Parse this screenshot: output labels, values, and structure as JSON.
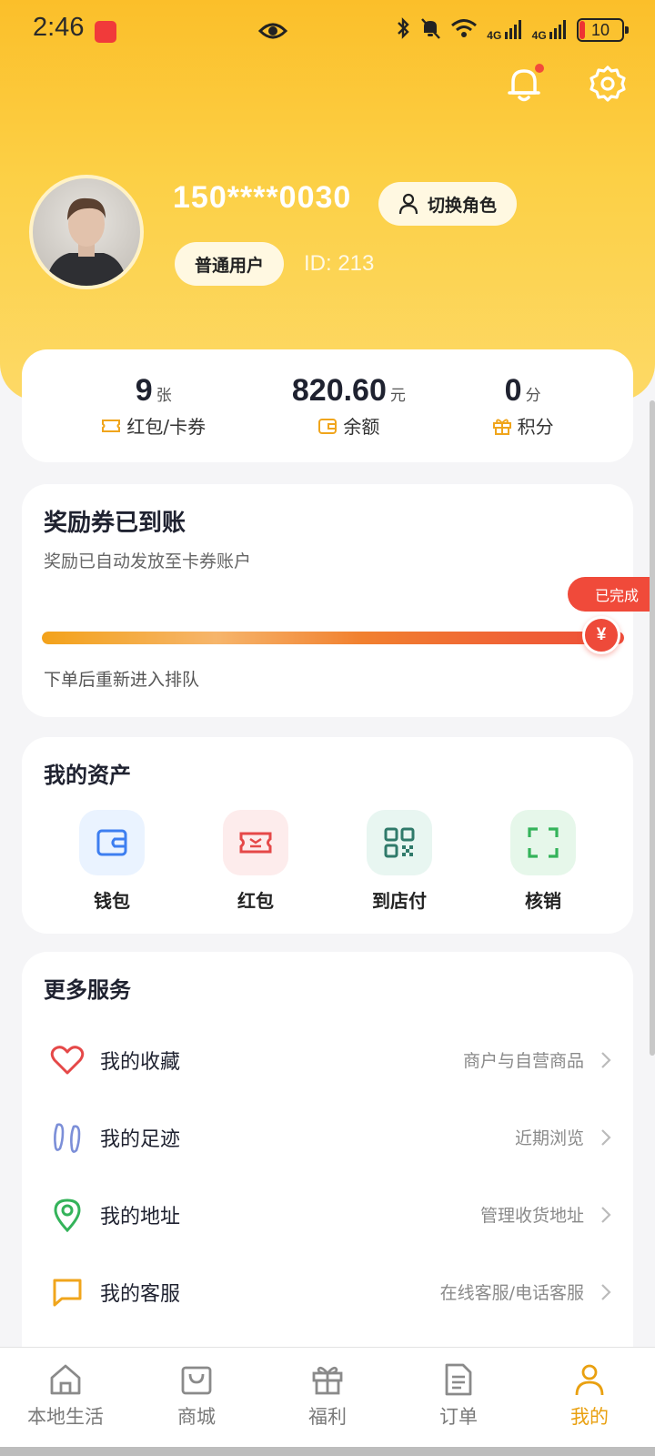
{
  "status_bar": {
    "time": "2:46",
    "network_1": "4G",
    "network_2": "4G",
    "battery": "10"
  },
  "profile": {
    "phone": "150****0030",
    "switch_role_label": "切换角色",
    "role_badge": "普通用户",
    "id_label": "ID:  213"
  },
  "stats": [
    {
      "value": "9",
      "unit": "张",
      "label": "红包/卡券",
      "icon": "ticket-icon"
    },
    {
      "value": "820.60",
      "unit": "元",
      "label": "余额",
      "icon": "wallet-icon"
    },
    {
      "value": "0",
      "unit": "分",
      "label": "积分",
      "icon": "gift-icon"
    }
  ],
  "reward": {
    "title": "奖励券已到账",
    "subtitle": "奖励已自动发放至卡券账户",
    "status_tag": "已完成",
    "knob_symbol": "¥",
    "progress": 1.0,
    "note": "下单后重新进入排队"
  },
  "assets": {
    "title": "我的资产",
    "items": [
      {
        "label": "钱包",
        "icon": "wallet-icon",
        "bg": "#eaf3ff",
        "color": "#3d7ef0"
      },
      {
        "label": "红包",
        "icon": "red-packet-icon",
        "bg": "#fdecec",
        "color": "#e54848"
      },
      {
        "label": "到店付",
        "icon": "qr-code-icon",
        "bg": "#e8f6f1",
        "color": "#2f7a6a"
      },
      {
        "label": "核销",
        "icon": "scan-icon",
        "bg": "#e6f7ea",
        "color": "#34b35a"
      }
    ]
  },
  "services": {
    "title": "更多服务",
    "items": [
      {
        "label": "我的收藏",
        "desc": "商户与自营商品",
        "icon": "heart-icon"
      },
      {
        "label": "我的足迹",
        "desc": "近期浏览",
        "icon": "footprint-icon"
      },
      {
        "label": "我的地址",
        "desc": "管理收货地址",
        "icon": "location-icon"
      },
      {
        "label": "我的客服",
        "desc": "在线客服/电话客服",
        "icon": "chat-icon"
      }
    ]
  },
  "tabs": [
    {
      "label": "本地生活",
      "icon": "home-icon"
    },
    {
      "label": "商城",
      "icon": "bag-icon"
    },
    {
      "label": "福利",
      "icon": "gift-icon"
    },
    {
      "label": "订单",
      "icon": "document-icon"
    },
    {
      "label": "我的",
      "icon": "user-icon",
      "active": true
    }
  ],
  "colors": {
    "accent": "#e9a010",
    "header": "#fcc937",
    "danger": "#ee4a3a"
  }
}
